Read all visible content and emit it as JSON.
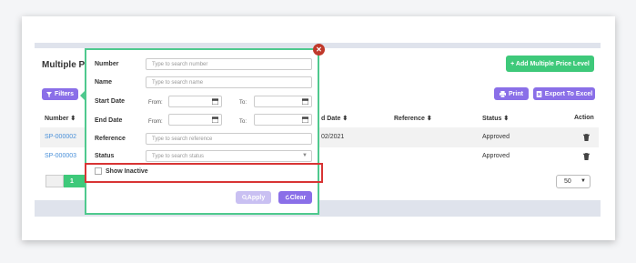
{
  "page": {
    "title": "Multiple Price",
    "add_button": "+ Add Multiple Price Level",
    "filters_button": "Filters",
    "print_button": "Print",
    "export_button": "Export To Excel"
  },
  "table": {
    "headers": {
      "number": "Number",
      "end_date": "d Date",
      "reference": "Reference",
      "status": "Status",
      "action": "Action"
    },
    "sort_glyph": "⬍",
    "rows": [
      {
        "number": "SP-000002",
        "end_date": "02/2021",
        "status": "Approved"
      },
      {
        "number": "SP-000003",
        "end_date": "",
        "status": "Approved"
      }
    ]
  },
  "pagination": {
    "current_page": "1",
    "page_size": "50"
  },
  "filter_panel": {
    "number_label": "Number",
    "number_placeholder": "Type to search number",
    "name_label": "Name",
    "name_placeholder": "Type to search name",
    "start_date_label": "Start Date",
    "end_date_label": "End Date",
    "from_label": "From:",
    "to_label": "To:",
    "reference_label": "Reference",
    "reference_placeholder": "Type to search reference",
    "status_label": "Status",
    "status_placeholder": "Type to search status",
    "show_inactive_label": "Show Inactive",
    "apply_button": "Apply",
    "clear_button": "Clear"
  },
  "colors": {
    "green": "#3ec97a",
    "purple": "#8a6fe8",
    "highlight": "#d83434",
    "link": "#4a90d9"
  }
}
